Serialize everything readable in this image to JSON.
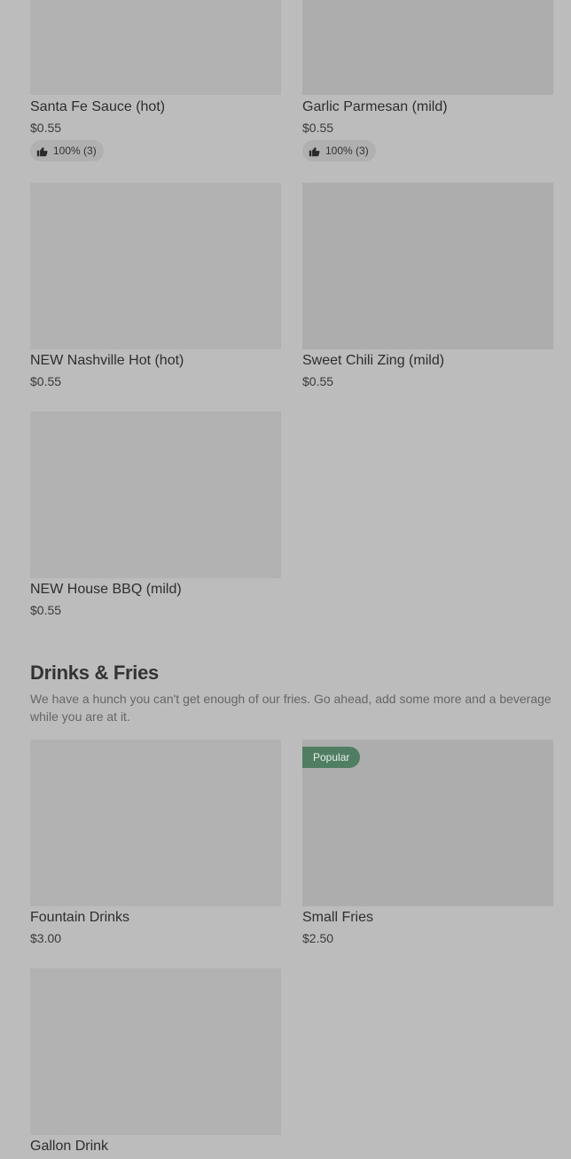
{
  "sauces": [
    {
      "name": "Santa Fe Sauce (hot)",
      "price": "$0.55",
      "rating": "100% (3)"
    },
    {
      "name": "Garlic Parmesan (mild)",
      "price": "$0.55",
      "rating": "100% (3)"
    },
    {
      "name": "NEW Nashville Hot (hot)",
      "price": "$0.55"
    },
    {
      "name": "Sweet Chili Zing (mild)",
      "price": "$0.55"
    },
    {
      "name": "NEW House BBQ (mild)",
      "price": "$0.55"
    }
  ],
  "section": {
    "title": "Drinks & Fries",
    "description": "We have a hunch you can't get enough of our fries. Go ahead, add some more and a beverage while you are at it."
  },
  "drinks": [
    {
      "name": "Fountain Drinks",
      "price": "$3.00"
    },
    {
      "name": "Small Fries",
      "price": "$2.50",
      "badge": "Popular"
    },
    {
      "name": "Gallon Drink"
    }
  ],
  "icons": {
    "rating": "thumbs-up-icon"
  },
  "colors": {
    "background": "#bcbcbc",
    "badge": "#4f7e63"
  }
}
